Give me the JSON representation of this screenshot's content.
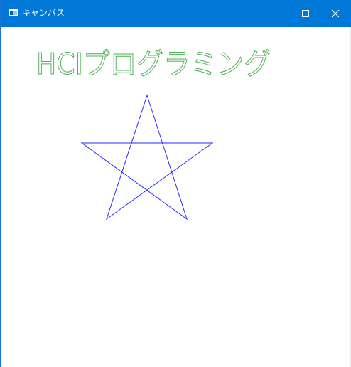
{
  "window": {
    "title": "キャンバス",
    "icon": "window-app-icon",
    "controls": {
      "minimize_icon": "minimize-icon",
      "maximize_icon": "maximize-icon",
      "close_icon": "close-icon"
    }
  },
  "canvas": {
    "text": "HCIプログラミング",
    "text_color": "#4caf50",
    "star_color": "#2a2aff",
    "shapes": [
      "text",
      "five-point-star"
    ]
  },
  "colors": {
    "titlebar": "#0078d7",
    "titlebar_text": "#ffffff",
    "background": "#ffffff"
  }
}
